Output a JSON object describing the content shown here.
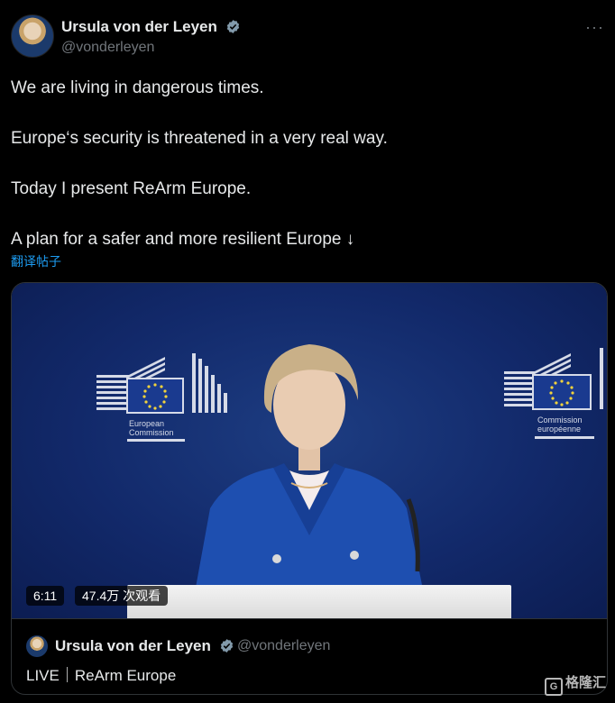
{
  "author": {
    "name": "Ursula von der Leyen",
    "handle": "@vonderleyen"
  },
  "more_label": "···",
  "tweet": {
    "lines": [
      "We are living in dangerous times.",
      "Europe‘s security is threatened in a very real way.",
      "Today I present ReArm Europe.",
      "A plan for a safer and more resilient Europe ↓"
    ],
    "translate_label": "翻译帖子"
  },
  "video": {
    "duration": "6:11",
    "views": "47.4万 次观看",
    "left_logo_text": [
      "European",
      "Commission"
    ],
    "right_logo_text": [
      "Commission",
      "européenne"
    ]
  },
  "card": {
    "author_name": "Ursula von der Leyen",
    "author_handle": "@vonderleyen",
    "title": "LIVE｜ReArm Europe"
  },
  "watermark": "格隆汇",
  "colors": {
    "background": "#000000",
    "link": "#1d9bf0",
    "secondary_text": "#71767b",
    "verified": "#829aab",
    "stage_blue": "#12296a",
    "jacket_blue": "#1e4fb0"
  }
}
